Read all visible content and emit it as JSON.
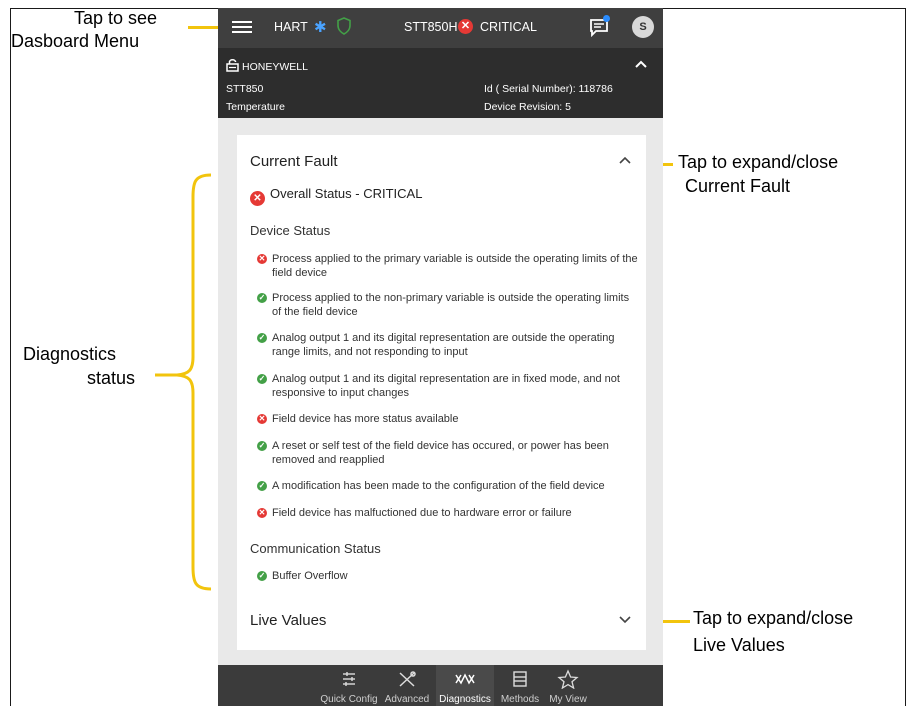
{
  "annotations": {
    "menu_line1": "Tap to see",
    "menu_line2": "Dasboard Menu",
    "fault_line1": "Tap to expand/close",
    "fault_line2": "Current Fault",
    "diag_line1": "Diagnostics",
    "diag_line2": "status",
    "live_line1": "Tap to expand/close",
    "live_line2": "Live Values"
  },
  "topbar": {
    "protocol": "HART",
    "device": "STT850H",
    "status": "CRITICAL",
    "avatar": "S"
  },
  "device_info": {
    "brand": "HONEYWELL",
    "model": "STT850",
    "variable": "Temperature",
    "serial": "Id ( Serial Number): 118786",
    "revision": "Device Revision: 5"
  },
  "current_fault": {
    "title": "Current Fault",
    "overall": "Overall Status - CRITICAL",
    "device_status_title": "Device Status",
    "device_status": [
      {
        "state": "error",
        "text": "Process applied to the primary variable is outside the operating limits of the field device"
      },
      {
        "state": "ok",
        "text": "Process applied to the non-primary variable is outside the operating limits of the field device"
      },
      {
        "state": "ok",
        "text": "Analog output 1 and its digital representation are outside the operating range limits, and not responding to input"
      },
      {
        "state": "ok",
        "text": "Analog output 1 and its digital representation are in fixed mode, and not responsive to input changes"
      },
      {
        "state": "error",
        "text": "Field device has more status available"
      },
      {
        "state": "ok",
        "text": "A reset or self test of the field device has occured, or power has been removed and reapplied"
      },
      {
        "state": "ok",
        "text": "A modification has been made to the configuration of the field device"
      },
      {
        "state": "error",
        "text": "Field device has malfuctioned due to hardware error or failure"
      }
    ],
    "comm_status_title": "Communication Status",
    "comm_status": [
      {
        "state": "ok",
        "text": "Buffer Overflow"
      }
    ]
  },
  "live_values": {
    "title": "Live Values"
  },
  "nav": [
    {
      "label": "Quick Config",
      "icon": "sliders-icon"
    },
    {
      "label": "Advanced",
      "icon": "tools-icon"
    },
    {
      "label": "Diagnostics",
      "icon": "diagnostics-icon"
    },
    {
      "label": "Methods",
      "icon": "methods-icon"
    },
    {
      "label": "My View",
      "icon": "star-icon"
    }
  ],
  "colors": {
    "error": "#e53935",
    "ok": "#43a047",
    "annotation_line": "#f2c40d",
    "topbar": "#3f3f3f"
  }
}
